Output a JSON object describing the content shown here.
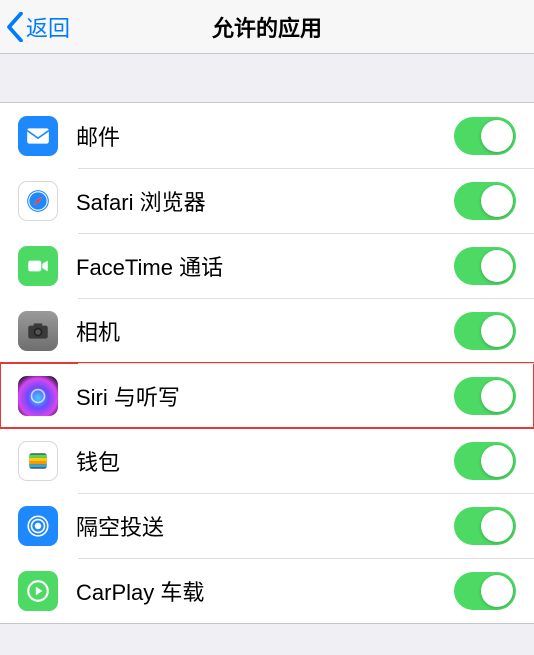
{
  "nav": {
    "back": "返回",
    "title": "允许的应用"
  },
  "apps": [
    {
      "id": "mail",
      "label": "邮件",
      "on": true,
      "highlight": false
    },
    {
      "id": "safari",
      "label": "Safari 浏览器",
      "on": true,
      "highlight": false
    },
    {
      "id": "facetime",
      "label": "FaceTime 通话",
      "on": true,
      "highlight": false
    },
    {
      "id": "camera",
      "label": "相机",
      "on": true,
      "highlight": false
    },
    {
      "id": "siri",
      "label": "Siri 与听写",
      "on": true,
      "highlight": true
    },
    {
      "id": "wallet",
      "label": "钱包",
      "on": true,
      "highlight": false
    },
    {
      "id": "airdrop",
      "label": "隔空投送",
      "on": true,
      "highlight": false
    },
    {
      "id": "carplay",
      "label": "CarPlay 车载",
      "on": true,
      "highlight": false
    }
  ]
}
